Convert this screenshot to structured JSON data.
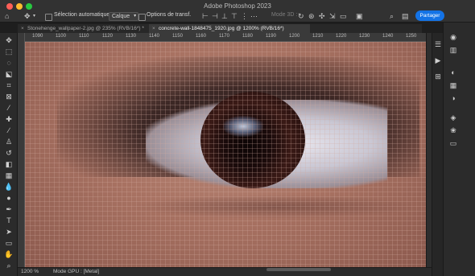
{
  "app": {
    "title": "Adobe Photoshop 2023"
  },
  "options_bar": {
    "move_icon": "move-tool-icon",
    "auto_select_label": "Sélection automatique :",
    "auto_select_value": "Calque",
    "transform_label": "Options de transf.",
    "mode3d_label": "Mode 3D :",
    "share_label": "Partager"
  },
  "tabs": [
    {
      "close": "×",
      "label": "Stonehenge_wallpaper-2.jpg @ 235% (RVB/16*) *"
    },
    {
      "close": "×",
      "label": "concrete-wall-1848475_1920.jpg @ 1200% (RVB/16*)"
    }
  ],
  "ruler": {
    "ticks": [
      "1090",
      "1100",
      "1110",
      "1120",
      "1130",
      "1140",
      "1150",
      "1160",
      "1170",
      "1180",
      "1190",
      "1200",
      "1210",
      "1220",
      "1230",
      "1240",
      "1250"
    ]
  },
  "status": {
    "zoom": "1200 %",
    "gpu_mode": "Mode GPU : [Metal]"
  },
  "tools": [
    "move-tool-icon",
    "marquee-tool-icon",
    "lasso-tool-icon",
    "object-select-tool-icon",
    "crop-tool-icon",
    "frame-tool-icon",
    "eyedropper-tool-icon",
    "healing-brush-icon",
    "brush-tool-icon",
    "clone-stamp-icon",
    "history-brush-icon",
    "eraser-tool-icon",
    "gradient-tool-icon",
    "blur-tool-icon",
    "dodge-tool-icon",
    "pen-tool-icon",
    "type-tool-icon",
    "path-select-icon",
    "rectangle-tool-icon",
    "hand-tool-icon",
    "zoom-tool-icon"
  ]
}
